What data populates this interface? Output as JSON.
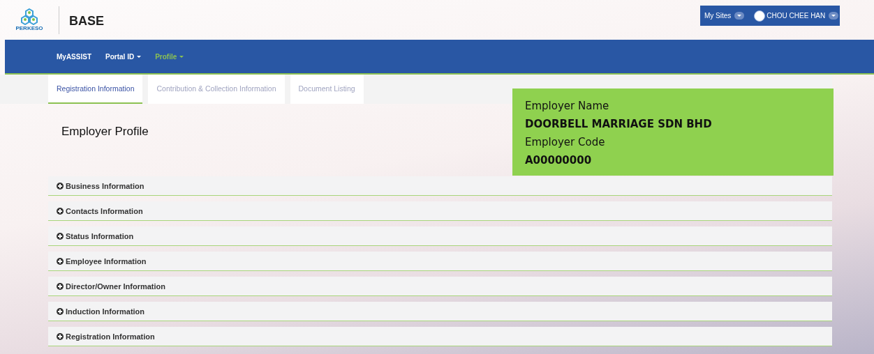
{
  "header": {
    "logo_text": "PERKESO",
    "app_title": "BASE",
    "my_sites": "My Sites",
    "user_name": "CHOU CHEE HAN"
  },
  "nav": [
    {
      "label": "MyASSIST",
      "dropdown": false,
      "selected": false
    },
    {
      "label": "Portal ID",
      "dropdown": true,
      "selected": false
    },
    {
      "label": "Profile",
      "dropdown": true,
      "selected": true
    }
  ],
  "tabs": [
    {
      "label": "Registration Information",
      "selected": true
    },
    {
      "label": "Contribution & Collection Information",
      "selected": false
    },
    {
      "label": "Document Listing",
      "selected": false
    }
  ],
  "page_title": "Employer Profile",
  "employer": {
    "name_label": "Employer Name",
    "name": "DOORBELL MARRIAGE SDN BHD",
    "code_label": "Employer Code",
    "code": "A00000000"
  },
  "sections": [
    {
      "label": "Business Information",
      "expanded": false
    },
    {
      "label": "Contacts Information",
      "expanded": false
    },
    {
      "label": "Status Information",
      "expanded": false
    },
    {
      "label": "Employee Information",
      "expanded": false
    },
    {
      "label": "Director/Owner Information",
      "expanded": false
    },
    {
      "label": "Induction Information",
      "expanded": false
    },
    {
      "label": "Registration Information",
      "expanded": false
    }
  ]
}
